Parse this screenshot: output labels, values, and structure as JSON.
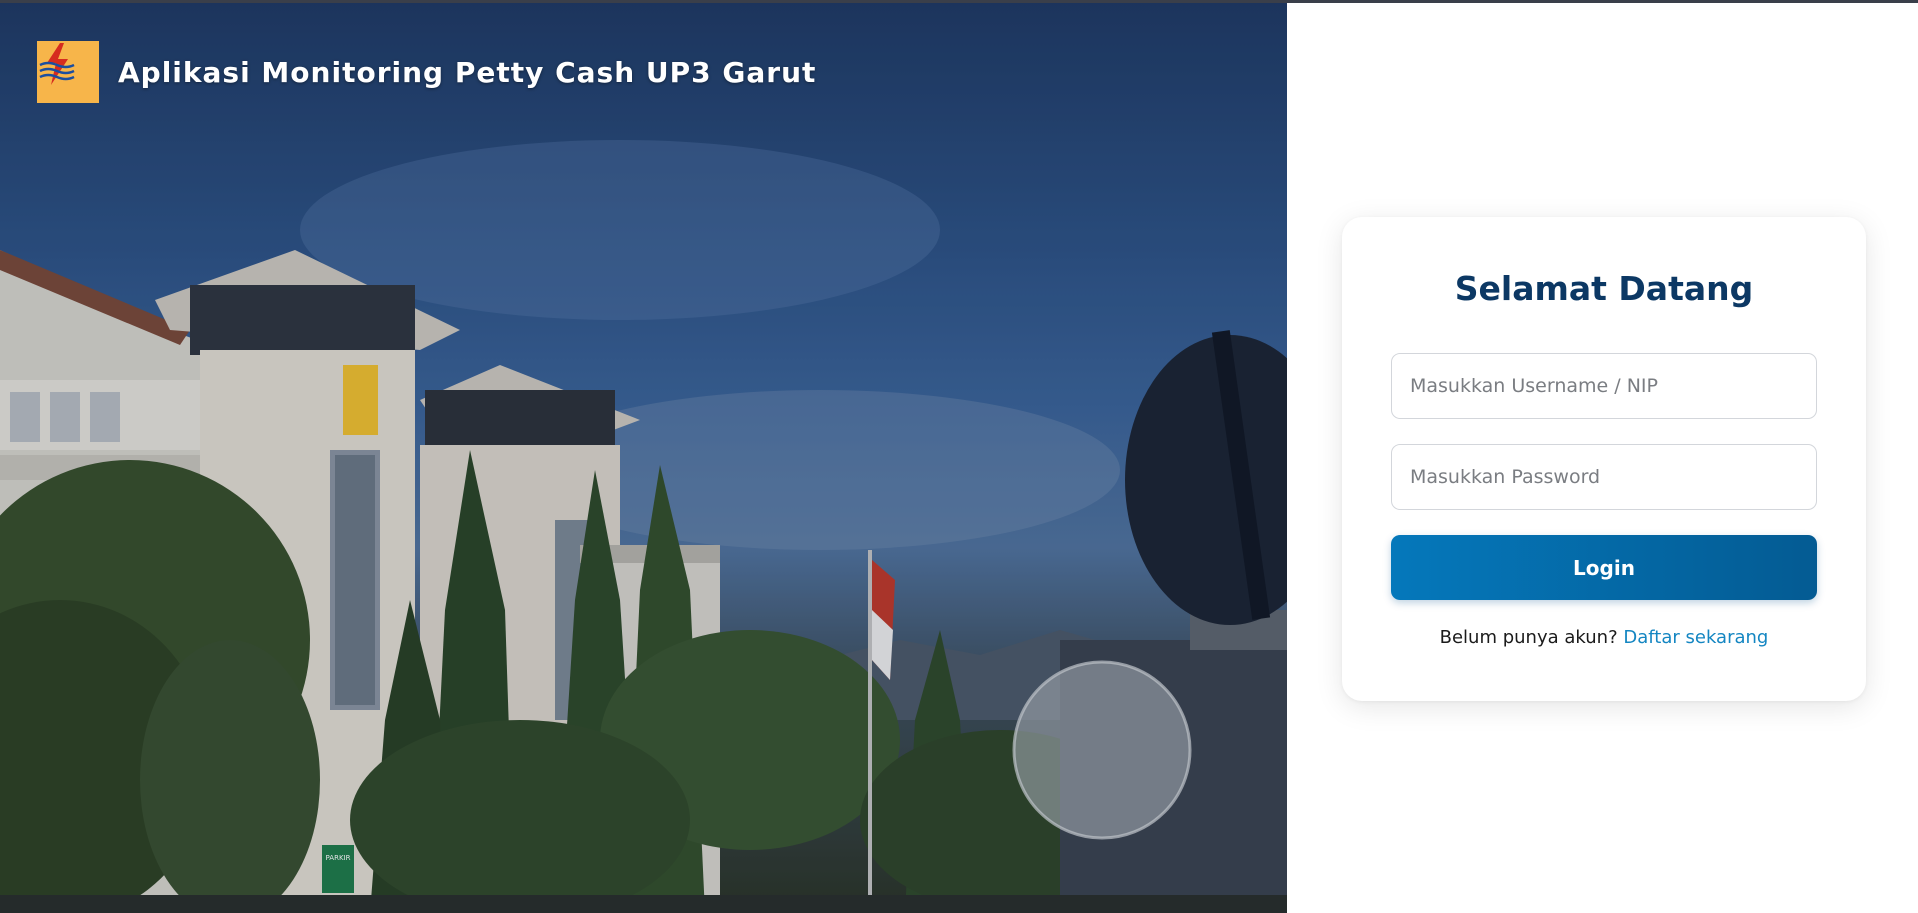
{
  "header": {
    "app_title": "Aplikasi Monitoring Petty Cash UP3 Garut",
    "logo_icon": "pln-lightning-logo-icon"
  },
  "login": {
    "heading": "Selamat Datang",
    "username_placeholder": "Masukkan Username / NIP",
    "username_value": "",
    "password_placeholder": "Masukkan Password",
    "password_value": "",
    "login_button": "Login",
    "register_prompt": "Belum punya akun?",
    "register_link": "Daftar sekarang"
  },
  "background": {
    "description_icon": "office-building-photo",
    "sign_text": "PARKIR MOBIL MUNDUR"
  },
  "colors": {
    "title": "#0c3864",
    "button_start": "#0578bb",
    "button_end": "#045b93",
    "link": "#1486c2",
    "logo_bg": "#f7b54a"
  }
}
